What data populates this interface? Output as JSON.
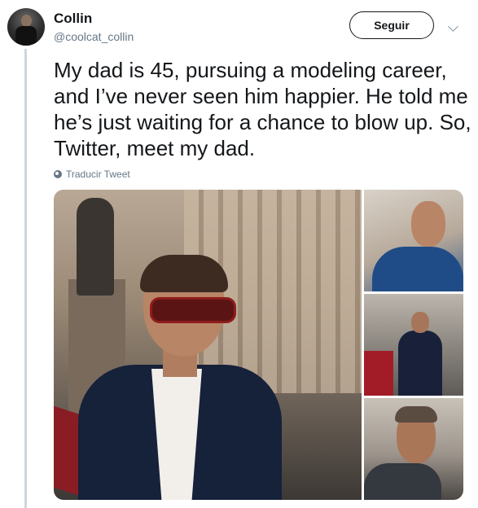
{
  "tweet": {
    "author": {
      "name": "Collin",
      "handle": "@coolcat_collin"
    },
    "follow_label": "Seguir",
    "text": "My dad is 45, pursuing a modeling career, and I’ve never seen him happier. He told me he’s just waiting for a chance to blow up. So, Twitter, meet my dad.",
    "translate_label": "Traducir Tweet",
    "media_count": 4
  },
  "colors": {
    "text_primary": "#14171a",
    "text_secondary": "#657786",
    "thread_line": "#ccd6dd"
  },
  "icons": [
    "avatar",
    "chevron-down-icon",
    "globe-icon"
  ]
}
